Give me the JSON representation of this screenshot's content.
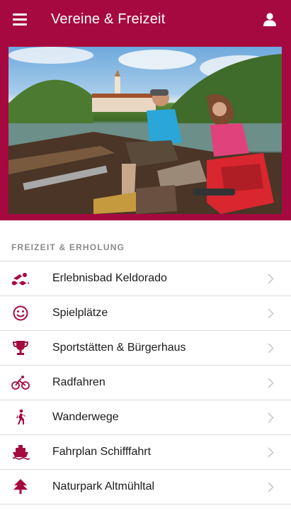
{
  "header": {
    "title": "Vereine & Freizeit",
    "menu_icon": "hamburger-menu-icon",
    "user_icon": "user-account-icon",
    "bar_color": "#a6093f"
  },
  "hero": {
    "description_icon": "photo-boat-couple"
  },
  "section": {
    "title": "FREIZEIT & ERHOLUNG"
  },
  "items": [
    {
      "label": "Erlebnisbad Keldorado",
      "icon": "swimming-icon"
    },
    {
      "label": "Spielplätze",
      "icon": "smiley-icon"
    },
    {
      "label": "Sportstätten & Bürgerhaus",
      "icon": "trophy-icon"
    },
    {
      "label": "Radfahren",
      "icon": "bicycle-icon"
    },
    {
      "label": "Wanderwege",
      "icon": "hiking-icon"
    },
    {
      "label": "Fahrplan Schifffahrt",
      "icon": "ship-icon"
    },
    {
      "label": "Naturpark Altmühltal",
      "icon": "tree-icon"
    }
  ],
  "colors": {
    "accent": "#a6093f",
    "chevron": "#c8c8c8"
  }
}
